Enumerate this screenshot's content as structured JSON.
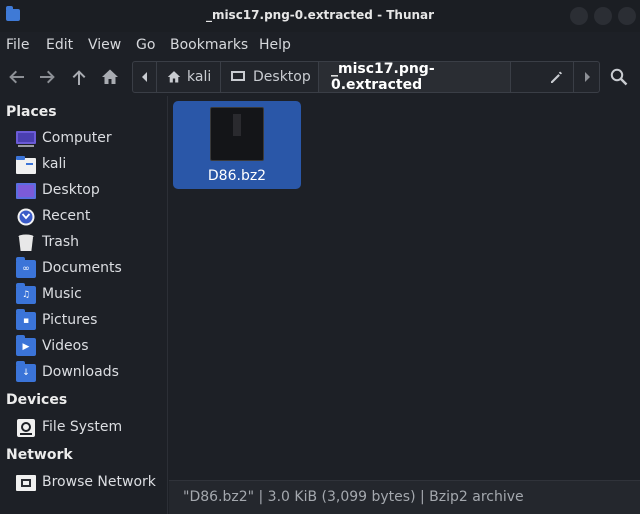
{
  "window": {
    "title": "_misc17.png-0.extracted - Thunar"
  },
  "menu": {
    "items": [
      "File",
      "Edit",
      "View",
      "Go",
      "Bookmarks",
      "Help"
    ]
  },
  "toolbar": {
    "icons": [
      "back-arrow-icon",
      "forward-arrow-icon",
      "up-arrow-icon",
      "home-icon"
    ]
  },
  "pathbar": {
    "segments": [
      "kali",
      "Desktop",
      "_misc17.png-0.extracted"
    ]
  },
  "sidebar": {
    "places_title": "Places",
    "places": [
      "Computer",
      "kali",
      "Desktop",
      "Recent",
      "Trash",
      "Documents",
      "Music",
      "Pictures",
      "Videos",
      "Downloads"
    ],
    "devices_title": "Devices",
    "devices": [
      "File System"
    ],
    "network_title": "Network",
    "network": [
      "Browse Network"
    ]
  },
  "files": [
    {
      "name": "D86.bz2",
      "selected": true
    }
  ],
  "status": {
    "text": "\"D86.bz2\" | 3.0 KiB (3,099 bytes) | Bzip2 archive"
  },
  "colors": {
    "accent": "#3b74d8",
    "selection": "#2a57a8",
    "background": "#1d2026"
  }
}
